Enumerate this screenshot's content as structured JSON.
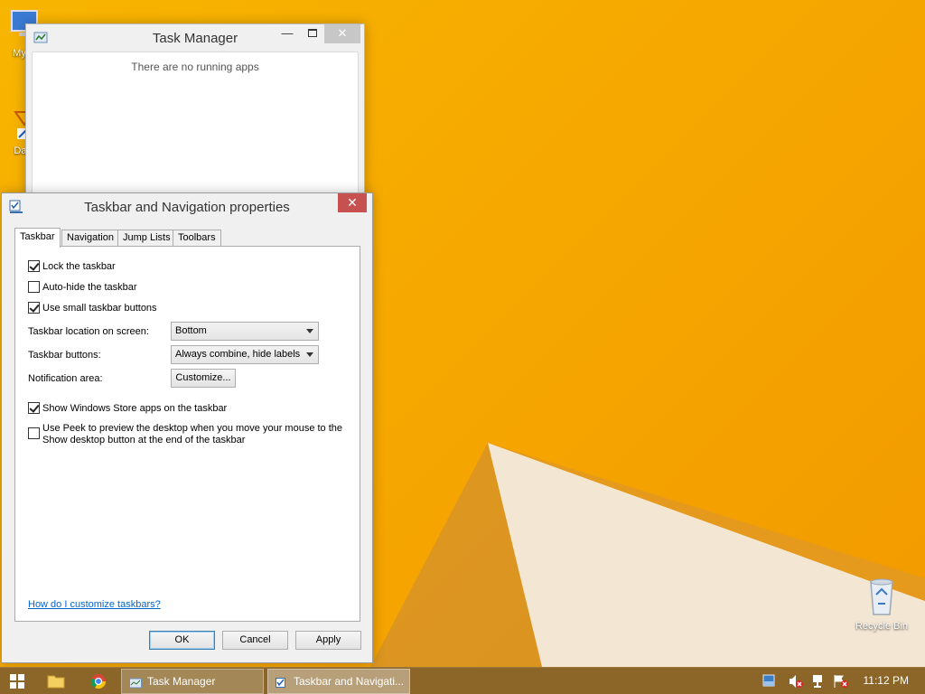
{
  "desktop": {
    "icons": [
      {
        "label": "My C",
        "name": "my-computer"
      },
      {
        "label": "Data",
        "name": "data-shortcut"
      },
      {
        "label": "Recycle Bin",
        "name": "recycle-bin"
      }
    ]
  },
  "task_manager": {
    "title": "Task Manager",
    "empty_message": "There are no running apps"
  },
  "properties_dialog": {
    "title": "Taskbar and Navigation properties",
    "close_symbol": "✕",
    "tabs": [
      "Taskbar",
      "Navigation",
      "Jump Lists",
      "Toolbars"
    ],
    "active_tab": "Taskbar",
    "checkboxes": [
      {
        "label": "Lock the taskbar",
        "checked": true
      },
      {
        "label": "Auto-hide the taskbar",
        "checked": false
      },
      {
        "label": "Use small taskbar buttons",
        "checked": true
      },
      {
        "label": "Show Windows Store apps on the taskbar",
        "checked": true
      },
      {
        "label": "Use Peek to preview the desktop when you move your mouse to the",
        "label_line2": "Show desktop button at the end of the taskbar",
        "checked": false
      }
    ],
    "location_label": "Taskbar location on screen:",
    "location_value": "Bottom",
    "buttons_label": "Taskbar buttons:",
    "buttons_value": "Always combine, hide labels",
    "notification_label": "Notification area:",
    "customize_label": "Customize...",
    "help_link": "How do I customize taskbars?",
    "ok_label": "OK",
    "cancel_label": "Cancel",
    "apply_label": "Apply"
  },
  "taskbar": {
    "tasks": [
      "Task Manager",
      "Taskbar and Navigati..."
    ],
    "clock": "11:12 PM"
  },
  "colors": {
    "wallpaper": "#f6a800",
    "close_red": "#c75050",
    "link": "#0066cc",
    "taskbar": "#8b6628"
  }
}
